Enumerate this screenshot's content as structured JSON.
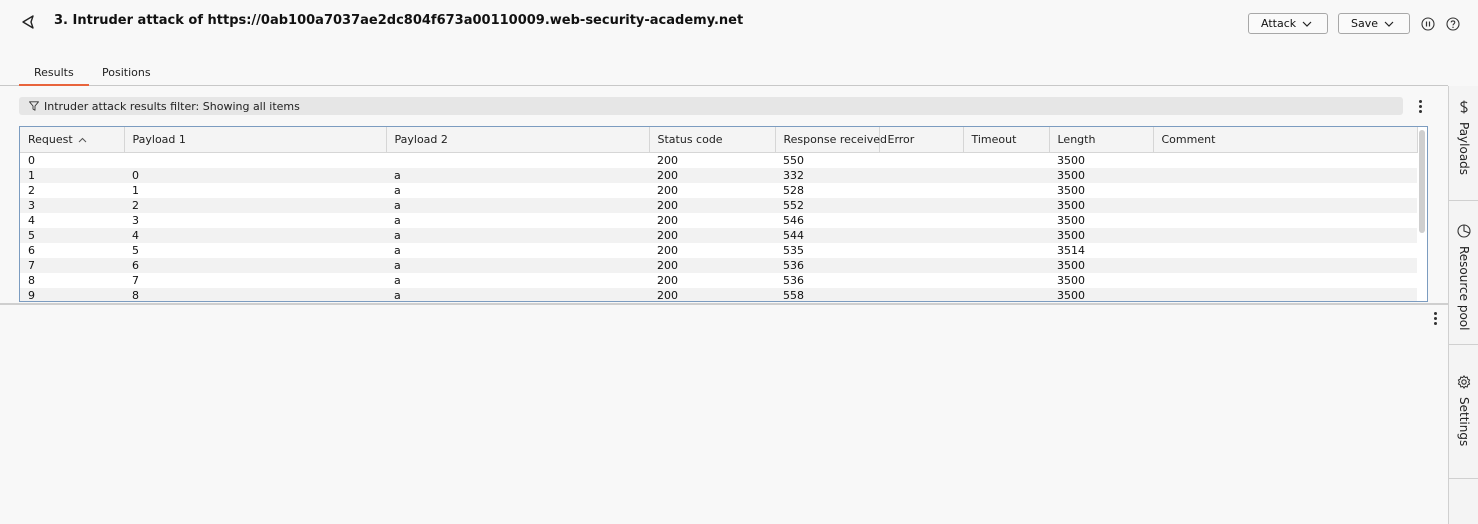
{
  "header": {
    "title": "3. Intruder attack of https://0ab100a7037ae2dc804f673a00110009.web-security-academy.net",
    "attack_label": "Attack",
    "save_label": "Save"
  },
  "tabs": [
    {
      "label": "Results",
      "active": true
    },
    {
      "label": "Positions",
      "active": false
    }
  ],
  "filter": {
    "text": "Intruder attack results filter: Showing all items"
  },
  "table": {
    "columns": [
      "Request",
      "Payload 1",
      "Payload 2",
      "Status code",
      "Response received",
      "Error",
      "Timeout",
      "Length",
      "Comment"
    ],
    "rows": [
      [
        "0",
        "",
        "",
        "200",
        "550",
        "",
        "",
        "3500",
        ""
      ],
      [
        "1",
        "0",
        "a",
        "200",
        "332",
        "",
        "",
        "3500",
        ""
      ],
      [
        "2",
        "1",
        "a",
        "200",
        "528",
        "",
        "",
        "3500",
        ""
      ],
      [
        "3",
        "2",
        "a",
        "200",
        "552",
        "",
        "",
        "3500",
        ""
      ],
      [
        "4",
        "3",
        "a",
        "200",
        "546",
        "",
        "",
        "3500",
        ""
      ],
      [
        "5",
        "4",
        "a",
        "200",
        "544",
        "",
        "",
        "3500",
        ""
      ],
      [
        "6",
        "5",
        "a",
        "200",
        "535",
        "",
        "",
        "3514",
        ""
      ],
      [
        "7",
        "6",
        "a",
        "200",
        "536",
        "",
        "",
        "3500",
        ""
      ],
      [
        "8",
        "7",
        "a",
        "200",
        "536",
        "",
        "",
        "3500",
        ""
      ],
      [
        "9",
        "8",
        "a",
        "200",
        "558",
        "",
        "",
        "3500",
        ""
      ]
    ]
  },
  "sidebar": {
    "payloads_label": "Payloads",
    "resource_pool_label": "Resource pool",
    "settings_label": "Settings"
  },
  "colors": {
    "accent": "#e8643c",
    "table_border": "#7c9cc0"
  }
}
